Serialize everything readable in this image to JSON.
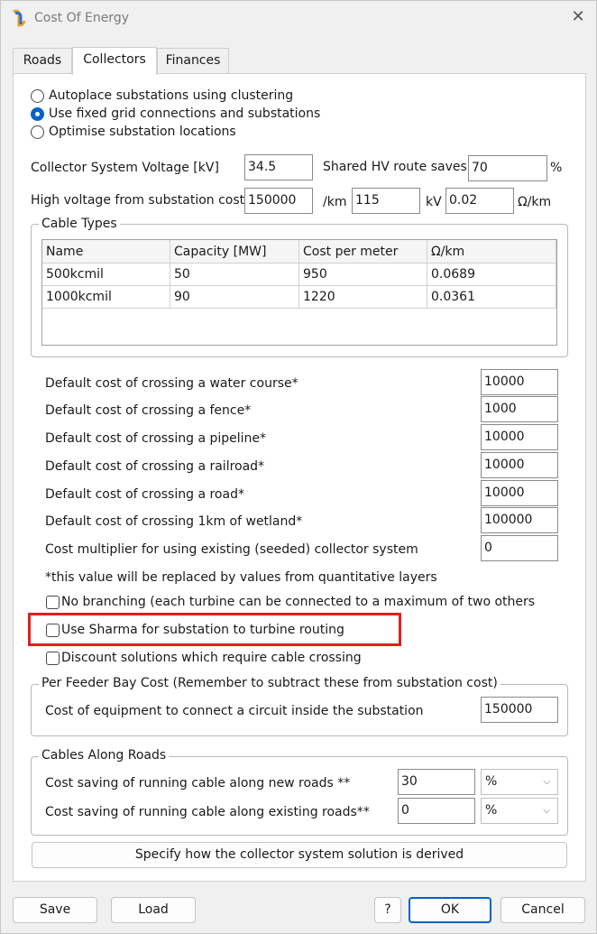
{
  "window": {
    "title": "Cost Of Energy",
    "app_icon": "app-logo-icon",
    "close_icon": "close-icon"
  },
  "tabs": [
    {
      "label": "Roads"
    },
    {
      "label": "Collectors"
    },
    {
      "label": "Finances"
    }
  ],
  "options": {
    "radio": [
      {
        "label": "Autoplace substations using clustering",
        "selected": false
      },
      {
        "label": "Use fixed grid connections and substations",
        "selected": true
      },
      {
        "label": "Optimise substation locations",
        "selected": false
      }
    ]
  },
  "voltage": {
    "label": "Collector System Voltage [kV]",
    "value": "34.5",
    "shared_label": "Shared HV route saves",
    "shared_value": "70",
    "shared_unit": "%"
  },
  "hv": {
    "label": "High voltage from substation costs",
    "cost_value": "150000",
    "cost_unit": "/km",
    "kv_value": "115",
    "kv_unit": "kV",
    "ohm_value": "0.02",
    "ohm_unit": "Ω/km"
  },
  "cable_types": {
    "title": "Cable Types",
    "headers": [
      "Name",
      "Capacity [MW]",
      "Cost per meter",
      "Ω/km"
    ],
    "rows": [
      [
        "500kcmil",
        "50",
        "950",
        "0.0689"
      ],
      [
        "1000kcmil",
        "90",
        "1220",
        "0.0361"
      ]
    ]
  },
  "crossings": [
    {
      "label": "Default cost of crossing a water course*",
      "value": "10000"
    },
    {
      "label": "Default cost of crossing a fence*",
      "value": "1000"
    },
    {
      "label": "Default cost of crossing a pipeline*",
      "value": "10000"
    },
    {
      "label": "Default cost of crossing a railroad*",
      "value": "10000"
    },
    {
      "label": "Default cost of crossing a road*",
      "value": "10000"
    },
    {
      "label": "Default cost of crossing 1km of wetland*",
      "value": "100000"
    },
    {
      "label": "Cost multiplier for using existing (seeded) collector system",
      "value": "0"
    }
  ],
  "note": "*this value will be replaced by values from quantitative layers",
  "checkboxes": [
    {
      "label": "No branching (each turbine can be connected to a maximum of two others",
      "checked": false
    },
    {
      "label": "Use Sharma for substation to turbine routing",
      "checked": false
    },
    {
      "label": "Discount solutions which require cable crossing",
      "checked": false
    }
  ],
  "feeder": {
    "title": "Per Feeder Bay Cost (Remember to subtract these from substation cost)",
    "label": "Cost of equipment to connect a circuit inside the substation",
    "value": "150000"
  },
  "roads": {
    "title": "Cables Along Roads",
    "rows": [
      {
        "label": "Cost saving of running cable along new roads **",
        "value": "30",
        "unit": "%"
      },
      {
        "label": "Cost saving of running cable along existing roads**",
        "value": "0",
        "unit": "%"
      }
    ]
  },
  "specify_button": "Specify how the collector system solution is derived",
  "footer": {
    "save": "Save",
    "load": "Load",
    "help": "?",
    "ok": "OK",
    "cancel": "Cancel"
  },
  "colors": {
    "accent": "#0064c8",
    "highlight": "#e0201e"
  }
}
